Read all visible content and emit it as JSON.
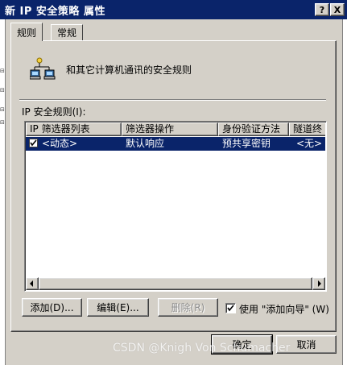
{
  "window": {
    "title": "新 IP 安全策略 属性",
    "help_button": "?",
    "close_button": "X"
  },
  "tabs": [
    {
      "label": "规则"
    },
    {
      "label": "常规"
    }
  ],
  "rules_tab": {
    "description": "和其它计算机通讯的安全规则",
    "list_label": "IP 安全规则(I):",
    "columns": [
      "IP 筛选器列表",
      "筛选器操作",
      "身份验证方法",
      "隧道终"
    ],
    "rows": [
      {
        "checked": true,
        "filter_list": "<动态>",
        "filter_action": "默认响应",
        "auth_method": "预共享密钥",
        "tunnel": "<无>"
      }
    ],
    "buttons": {
      "add": "添加(D)...",
      "edit": "编辑(E)...",
      "delete": "删除(R)"
    },
    "use_wizard": {
      "label": "使用 \"添加向导\" (W)",
      "checked": true
    }
  },
  "footer": {
    "ok": "确定",
    "cancel": "取消"
  },
  "watermark": "CSDN @Knigh Von Schumacher",
  "colors": {
    "titlebar": "#0a246a",
    "selection": "#0a246a",
    "face": "#d4d0c8"
  }
}
